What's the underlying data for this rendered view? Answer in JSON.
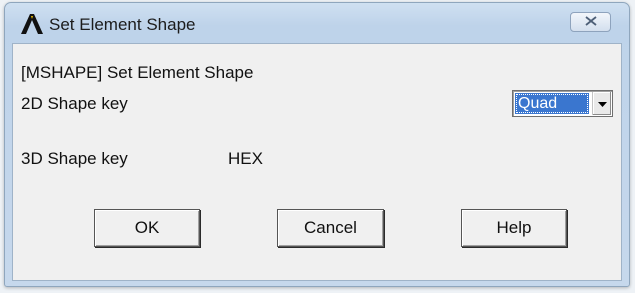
{
  "window": {
    "title": "Set Element Shape",
    "app_icon": "ansys-logo-icon",
    "close_icon": "close-icon"
  },
  "dialog": {
    "command_label": "[MSHAPE] Set Element Shape",
    "shape2d_label": "2D Shape key",
    "shape2d_selected": "Quad",
    "shape3d_label": "3D Shape key",
    "shape3d_value": "HEX"
  },
  "buttons": {
    "ok": "OK",
    "cancel": "Cancel",
    "help": "Help"
  },
  "colors": {
    "selection": "#3a76cf",
    "titlebar": "#c6d8ec",
    "client_bg": "#f0f0f0"
  }
}
